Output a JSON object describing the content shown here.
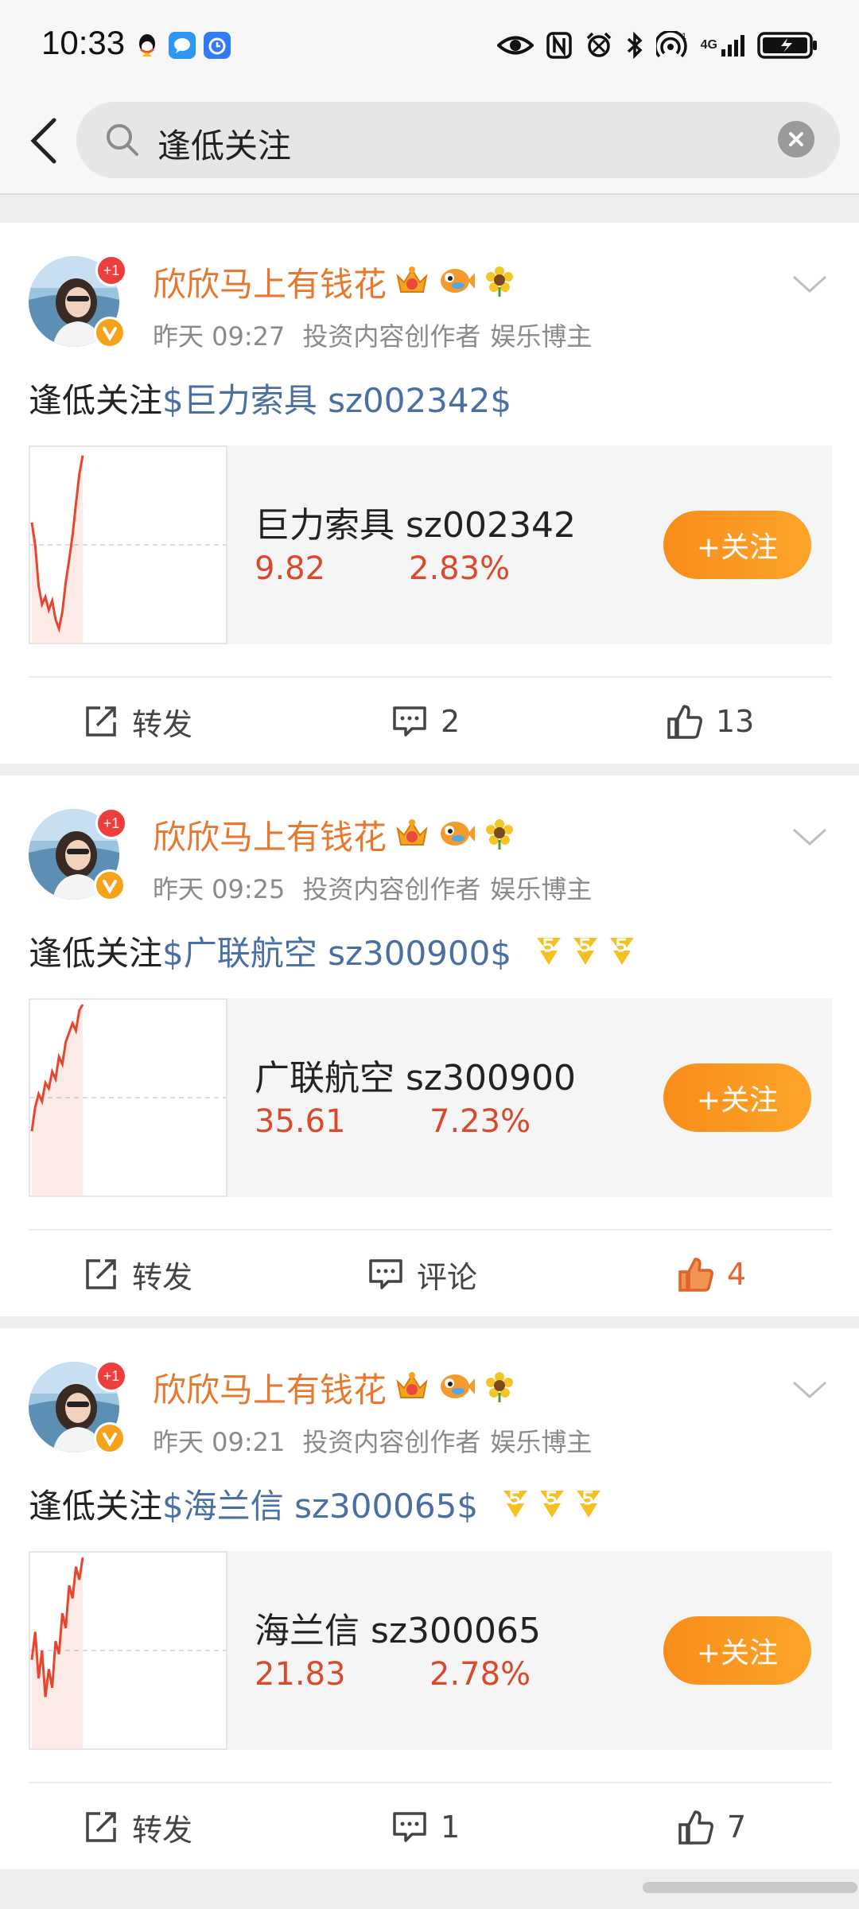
{
  "status_bar": {
    "time": "10:33",
    "network": "4G",
    "left_icons": [
      "qq-icon",
      "message-app-icon",
      "alarm-app-icon"
    ],
    "right_icons": [
      "eye-icon",
      "nfc-icon",
      "alarm-icon",
      "bluetooth-icon",
      "hotspot-icon",
      "signal-icon",
      "battery-icon"
    ]
  },
  "search": {
    "query": "逢低关注"
  },
  "posts": [
    {
      "user_name": "欣欣马上有钱花",
      "plus_badge": "+1",
      "time": "昨天 09:27",
      "tag1": "投资内容创作者",
      "tag2": "娱乐博主",
      "text_prefix": "逢低关注",
      "stock_tag": "$巨力索具 sz002342$",
      "stock_card": {
        "name": "巨力索具 sz002342",
        "price": "9.82",
        "change": "2.83%",
        "follow_label": "+关注",
        "trend": [
          0.62,
          0.5,
          0.28,
          0.18,
          0.22,
          0.15,
          0.2,
          0.1,
          0.05,
          0.14,
          0.3,
          0.42,
          0.55,
          0.72,
          0.88,
          0.98
        ]
      },
      "actions": {
        "repost": "转发",
        "comment": "2",
        "like": "13",
        "liked": false
      }
    },
    {
      "user_name": "欣欣马上有钱花",
      "plus_badge": "+1",
      "time": "昨天 09:25",
      "tag1": "投资内容创作者",
      "tag2": "娱乐博主",
      "text_prefix": "逢低关注",
      "stock_tag": "$广联航空 sz300900$",
      "stock_card": {
        "name": "广联航空 sz300900",
        "price": "35.61",
        "change": "7.23%",
        "follow_label": "+关注",
        "trend": [
          0.32,
          0.45,
          0.52,
          0.48,
          0.58,
          0.55,
          0.64,
          0.6,
          0.72,
          0.68,
          0.8,
          0.85,
          0.9,
          0.86,
          0.97,
          1.0
        ]
      },
      "actions": {
        "repost": "转发",
        "comment": "评论",
        "like": "4",
        "liked": true
      }
    },
    {
      "user_name": "欣欣马上有钱花",
      "plus_badge": "+1",
      "time": "昨天 09:21",
      "tag1": "投资内容创作者",
      "tag2": "娱乐博主",
      "text_prefix": "逢低关注",
      "stock_tag": "$海兰信 sz300065$",
      "stock_card": {
        "name": "海兰信 sz300065",
        "price": "21.83",
        "change": "2.78%",
        "follow_label": "+关注",
        "trend": [
          0.45,
          0.6,
          0.35,
          0.5,
          0.25,
          0.4,
          0.3,
          0.55,
          0.48,
          0.7,
          0.62,
          0.85,
          0.78,
          0.95,
          0.88,
          1.0
        ]
      },
      "actions": {
        "repost": "转发",
        "comment": "1",
        "like": "7",
        "liked": false
      }
    }
  ],
  "colors": {
    "username": "#e8782d",
    "stock_tag": "#4a6fa3",
    "price_up": "#d94a2c",
    "follow_button": "#f98d19",
    "liked": "#e8622b"
  }
}
